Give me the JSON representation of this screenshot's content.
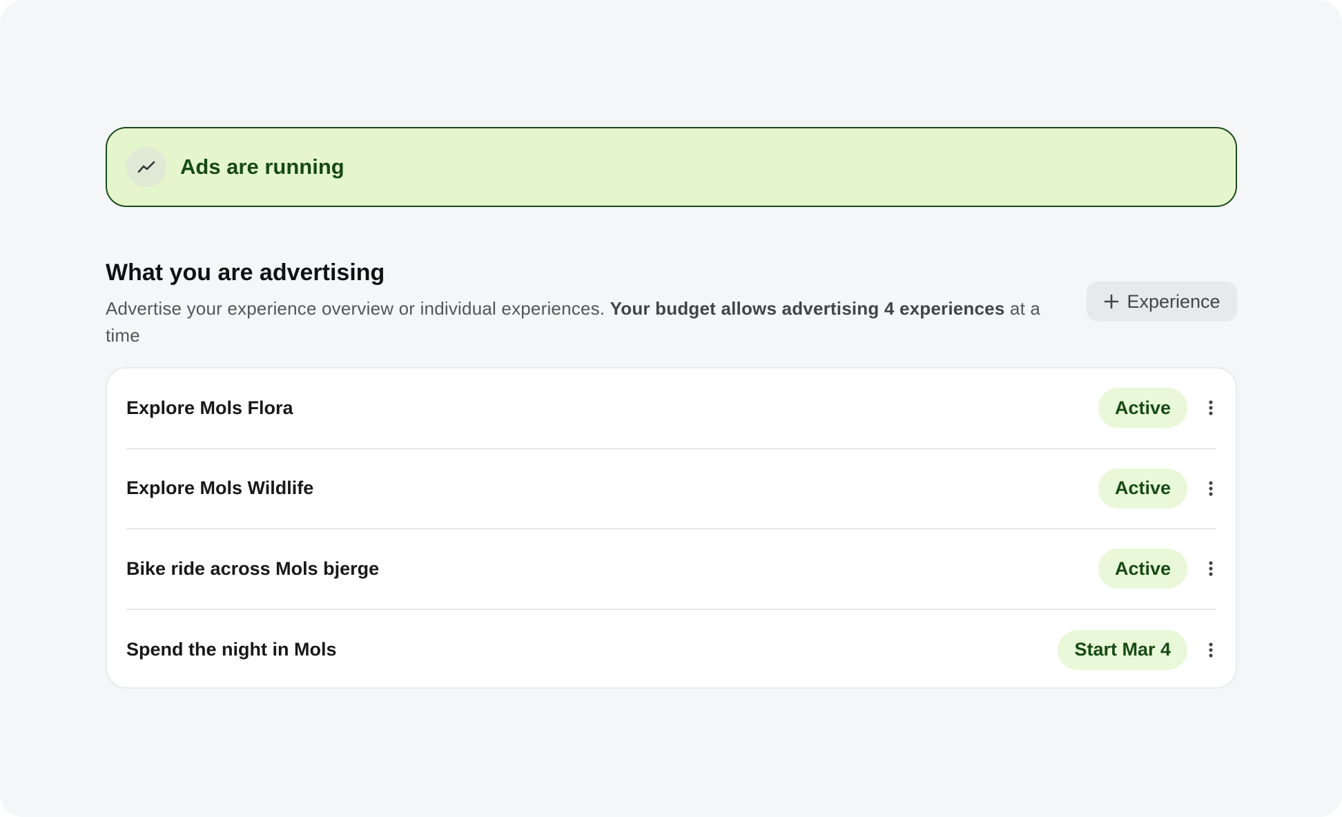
{
  "banner": {
    "icon": "trending-line-icon",
    "text": "Ads are running"
  },
  "section": {
    "title": "What you are advertising",
    "description_plain": "Advertise your experience overview or individual experiences. ",
    "description_bold": "Your budget allows advertising 4 experiences",
    "description_tail": " at a time",
    "add_button_label": "Experience",
    "add_button_icon": "plus-icon"
  },
  "experiences": [
    {
      "title": "Explore Mols Flora",
      "status": "Active"
    },
    {
      "title": "Explore Mols Wildlife",
      "status": "Active"
    },
    {
      "title": "Bike ride across Mols bjerge",
      "status": "Active"
    },
    {
      "title": "Spend the night in Mols",
      "status": "Start Mar 4"
    }
  ],
  "colors": {
    "banner_bg": "#e5f5cc",
    "banner_border": "#1a4a1a",
    "status_pill_bg": "#e8f8d8",
    "status_text": "#174a14"
  }
}
